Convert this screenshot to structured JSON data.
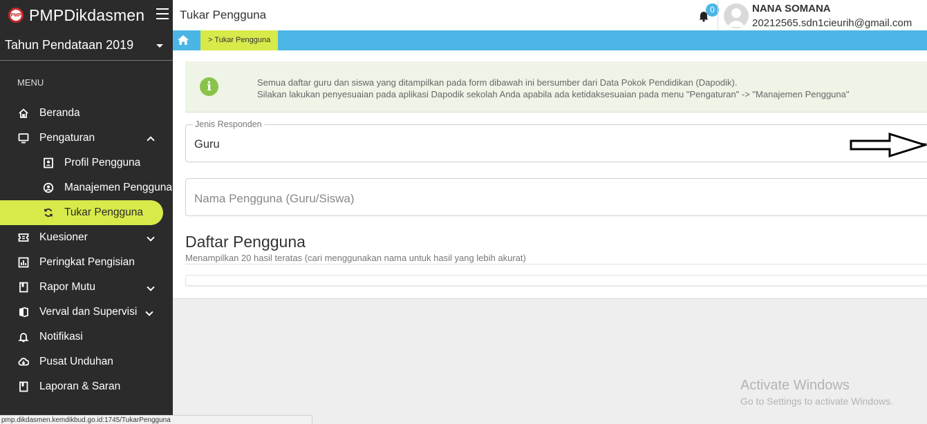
{
  "brand": {
    "title": "PMPDikdasmen",
    "logo_text": "PMP"
  },
  "year_select": {
    "value": "Tahun Pendataan 2019"
  },
  "menu": {
    "header": "MENU",
    "items": [
      {
        "label": "Beranda"
      },
      {
        "label": "Pengaturan"
      },
      {
        "label": "Profil Pengguna"
      },
      {
        "label": "Manajemen Pengguna"
      },
      {
        "label": "Tukar Pengguna"
      },
      {
        "label": "Kuesioner"
      },
      {
        "label": "Peringkat Pengisian"
      },
      {
        "label": "Rapor Mutu"
      },
      {
        "label": "Verval dan Supervisi"
      },
      {
        "label": "Notifikasi"
      },
      {
        "label": "Pusat Unduhan"
      },
      {
        "label": "Laporan & Saran"
      }
    ]
  },
  "topbar": {
    "page_title": "Tukar Pengguna",
    "notif_count": "0",
    "user_name": "NANA SOMANA",
    "user_email": "20212565.sdn1cieurih@gmail.com"
  },
  "breadcrumb": {
    "current": "> Tukar Pengguna"
  },
  "info": {
    "line1": "Semua daftar guru dan siswa yang ditampilkan pada form dibawah ini bersumber dari Data Pokok Pendidikan (Dapodik).",
    "line2": "Silakan lakukan penyesuaian pada aplikasi Dapodik sekolah Anda apabila ada ketidaksesuaian pada menu \"Pengaturan\" -> \"Manajemen Pengguna\""
  },
  "form": {
    "jenis_label": "Jenis Responden",
    "jenis_value": "Guru",
    "nama_placeholder": "Nama Pengguna (Guru/Siswa)"
  },
  "list": {
    "title": "Daftar Pengguna",
    "subtitle": "Menampilkan 20 hasil teratas (cari menggunakan nama untuk hasil yang lebih akurat)"
  },
  "watermark": {
    "title": "Activate Windows",
    "subtitle": "Go to Settings to activate Windows."
  },
  "statusbar": {
    "url": "pmp.dikdasmen.kemdikbud.go.id:1745/TukarPengguna"
  },
  "colors": {
    "accent_blue": "#4bb6e6",
    "accent_lime": "#d7ea4a",
    "sidebar_bg": "#2b2b2b",
    "info_green": "#8bc34a"
  }
}
